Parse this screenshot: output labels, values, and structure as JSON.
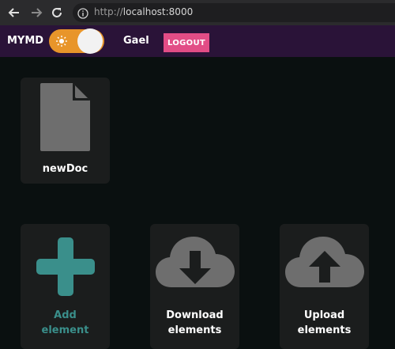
{
  "browser": {
    "url_protocol": "http://",
    "url_host": "localhost:8000",
    "icons": [
      "back-arrow-icon",
      "forward-arrow-icon",
      "reload-icon",
      "info-icon"
    ]
  },
  "header": {
    "brand": "MYMD",
    "theme_toggle": {
      "icon": "sun-icon",
      "state": "light"
    },
    "username": "Gael",
    "logout_label": "LOGOUT"
  },
  "documents": [
    {
      "name": "newDoc",
      "icon": "document-icon"
    }
  ],
  "actions": {
    "add": {
      "line1": "Add",
      "line2": "element",
      "icon": "plus-icon",
      "color": "#3a8f8b"
    },
    "download": {
      "line1": "Download",
      "line2": "elements",
      "icon": "cloud-download-icon"
    },
    "upload": {
      "line1": "Upload",
      "line2": "elements",
      "icon": "cloud-upload-icon"
    }
  },
  "colors": {
    "appbar": "#2a1338",
    "toggle": "#e8952a",
    "logout": "#e24d86",
    "card": "#1b1d1d",
    "icon_grey": "#6e6e6e",
    "accent_teal": "#3a8f8b"
  }
}
